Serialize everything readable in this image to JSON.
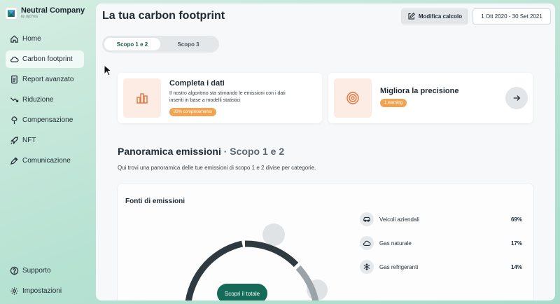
{
  "brand": {
    "name": "Neutral Company",
    "sub": "by Up2You"
  },
  "sidebar": {
    "items": [
      {
        "label": "Home",
        "icon": "home-icon"
      },
      {
        "label": "Carbon footprint",
        "icon": "cloud-icon",
        "active": true
      },
      {
        "label": "Report avanzato",
        "icon": "document-icon"
      },
      {
        "label": "Riduzione",
        "icon": "trend-down-icon"
      },
      {
        "label": "Compensazione",
        "icon": "tree-icon"
      },
      {
        "label": "NFT",
        "icon": "rocket-icon"
      },
      {
        "label": "Comunicazione",
        "icon": "pen-icon"
      }
    ],
    "bottom": [
      {
        "label": "Supporto",
        "icon": "help-icon"
      },
      {
        "label": "Impostazioni",
        "icon": "gear-icon"
      }
    ]
  },
  "header": {
    "title": "La tua carbon footprint",
    "edit_label": "Modifica calcolo",
    "date_range": "1 Ott 2020 - 30 Set 2021"
  },
  "tabs": [
    {
      "label": "Scopo 1 e 2",
      "active": true
    },
    {
      "label": "Scopo 3",
      "active": false
    }
  ],
  "cards": {
    "complete": {
      "title": "Completa i dati",
      "desc": "Il nostro algoritmo sta stimando le emissioni con i dati inseriti in base a modelli statistici",
      "badge": "83% completamento",
      "progress_percent": 83
    },
    "precision": {
      "title": "Migliora la precisione",
      "badge": "1 warning"
    }
  },
  "overview": {
    "title": "Panoramica emissioni",
    "title_sub": "Scopo 1 e 2",
    "desc": "Qui trovi una panoramica delle tue emissioni di scopo 1 e 2 divise per categorie."
  },
  "sources": {
    "title": "Fonti di emissioni",
    "items": [
      {
        "label": "Veicoli aziendali",
        "value": "69%",
        "icon": "car-icon"
      },
      {
        "label": "Gas naturale",
        "value": "17%",
        "icon": "cloud-icon"
      },
      {
        "label": "Gas refrigeranti",
        "value": "14%",
        "icon": "snowflake-icon"
      }
    ],
    "discover_label": "Scopri il totale"
  },
  "colors": {
    "accent": "#146b57",
    "badge": "#f0a453",
    "donut_dark": "#2e3a40",
    "donut_mid": "#9aa4a8"
  }
}
